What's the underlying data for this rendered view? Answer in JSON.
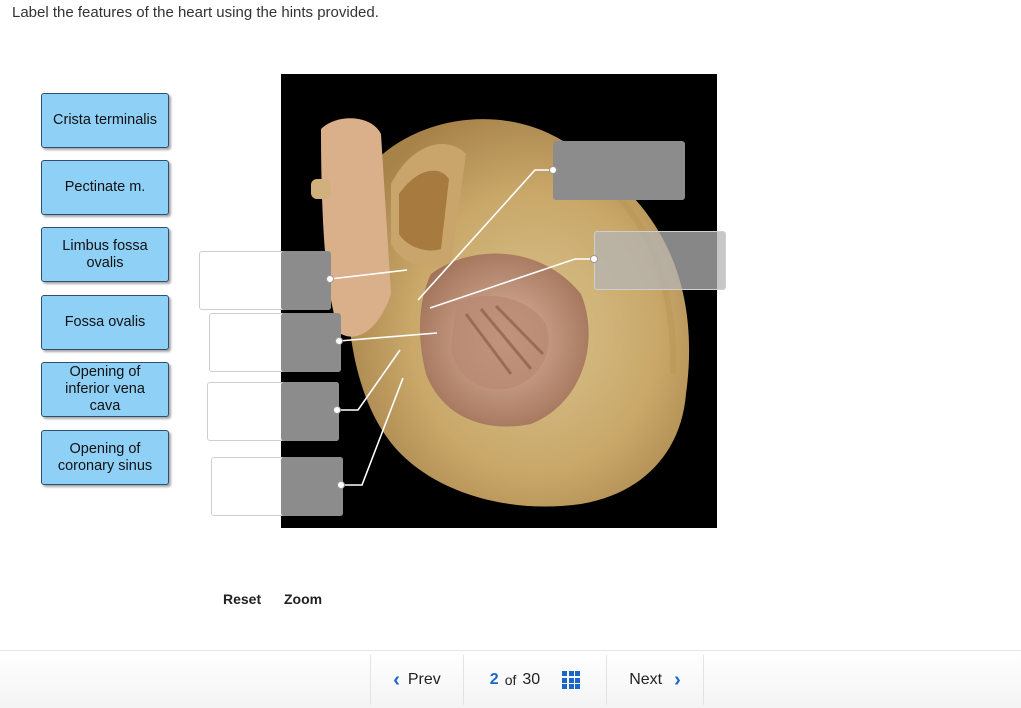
{
  "instruction": "Label the features of the heart using the hints provided.",
  "labels": [
    {
      "text": "Crista terminalis"
    },
    {
      "text": "Pectinate m."
    },
    {
      "text": "Limbus fossa ovalis"
    },
    {
      "text": "Fossa ovalis"
    },
    {
      "text": "Opening of inferior vena cava"
    },
    {
      "text": "Opening of coronary sinus"
    }
  ],
  "tools": {
    "reset": "Reset",
    "zoom": "Zoom"
  },
  "nav": {
    "prev": "Prev",
    "current": "2",
    "of": "of",
    "total": "30",
    "next": "Next"
  }
}
